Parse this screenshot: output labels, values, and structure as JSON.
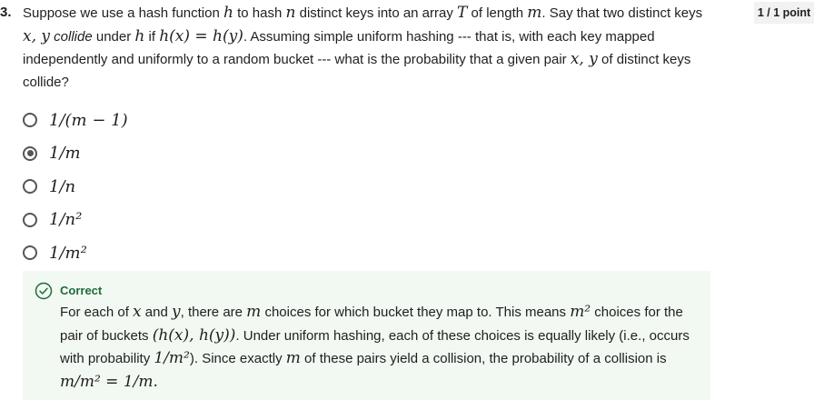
{
  "question": {
    "number": "3.",
    "points": "1 / 1 point",
    "text": {
      "a": "Suppose we use a hash function ",
      "h": "h",
      "b": " to hash ",
      "n": "n",
      "c": " distinct keys into an array ",
      "T": "T",
      "d": " of length ",
      "m": "m",
      "e": ". Say that two distinct keys ",
      "xy": "x, y",
      "f": " collide",
      "g": " under ",
      "h2": "h",
      "i": " if ",
      "eq": "h(x) = h(y)",
      "j": ". Assuming simple uniform hashing --- that is, with each key mapped independently and uniformly to a random bucket --- what is the probability that a given pair ",
      "xy2": "x, y",
      "k": " of distinct keys collide?"
    }
  },
  "options": [
    {
      "label": "1/(m − 1)",
      "selected": false
    },
    {
      "label": "1/m",
      "selected": true
    },
    {
      "label": "1/n",
      "selected": false
    },
    {
      "label": "1/n²",
      "selected": false
    },
    {
      "label": "1/m²",
      "selected": false
    }
  ],
  "feedback": {
    "status": "Correct",
    "icon": "check-circle-icon",
    "accent": "#1f6b3a",
    "text": {
      "a": "For each of ",
      "x": "x",
      "b": " and ",
      "y": "y",
      "c": ", there are ",
      "m": "m",
      "d": " choices for which bucket they map to. This means ",
      "m2": "m²",
      "e": " choices for the pair of buckets ",
      "pair": "(h(x), h(y))",
      "f": ". Under uniform hashing, each of these choices is equally likely (i.e., occurs with probability ",
      "frac": "1/m²",
      "g": "). Since exactly ",
      "m3": "m",
      "h": " of these pairs yield a collision, the probability of a collision is ",
      "final": "m/m² = 1/m."
    }
  }
}
